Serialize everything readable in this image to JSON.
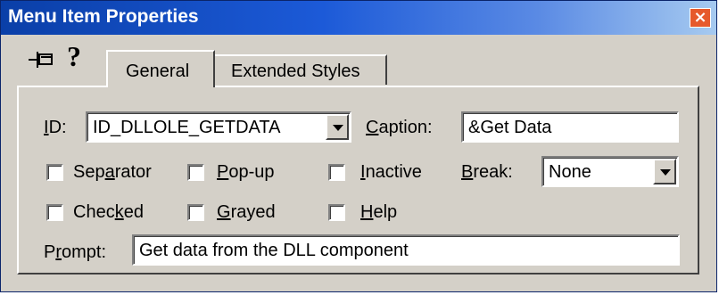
{
  "window": {
    "title": "Menu Item Properties",
    "close_glyph": "×"
  },
  "toolbar": {
    "pin_icon": "pushpin-icon",
    "help_glyph": "?"
  },
  "tabs": [
    {
      "label": "General",
      "selected": true
    },
    {
      "label": "Extended Styles",
      "selected": false
    }
  ],
  "id_field": {
    "label_pre": "",
    "label_mnemonic": "I",
    "label_post": "D:",
    "value": "ID_DLLOLE_GETDATA"
  },
  "caption_field": {
    "label_pre": "",
    "label_mnemonic": "C",
    "label_post": "aption:",
    "value": "&Get Data"
  },
  "checkboxes": {
    "separator": {
      "pre": "Sep",
      "mnemonic": "a",
      "post": "rator",
      "checked": false
    },
    "popup": {
      "pre": "",
      "mnemonic": "P",
      "post": "op-up",
      "checked": false
    },
    "inactive": {
      "pre": "",
      "mnemonic": "I",
      "post": "nactive",
      "checked": false
    },
    "checked": {
      "pre": "Chec",
      "mnemonic": "k",
      "post": "ed",
      "checked": false
    },
    "grayed": {
      "pre": "",
      "mnemonic": "G",
      "post": "rayed",
      "checked": false
    },
    "help": {
      "pre": "",
      "mnemonic": "H",
      "post": "elp",
      "checked": false
    }
  },
  "break_field": {
    "label_pre": "",
    "label_mnemonic": "B",
    "label_post": "reak:",
    "value": "None"
  },
  "prompt_field": {
    "label_pre": "P",
    "label_mnemonic": "r",
    "label_post": "ompt:",
    "value": "Get data from the DLL component"
  }
}
